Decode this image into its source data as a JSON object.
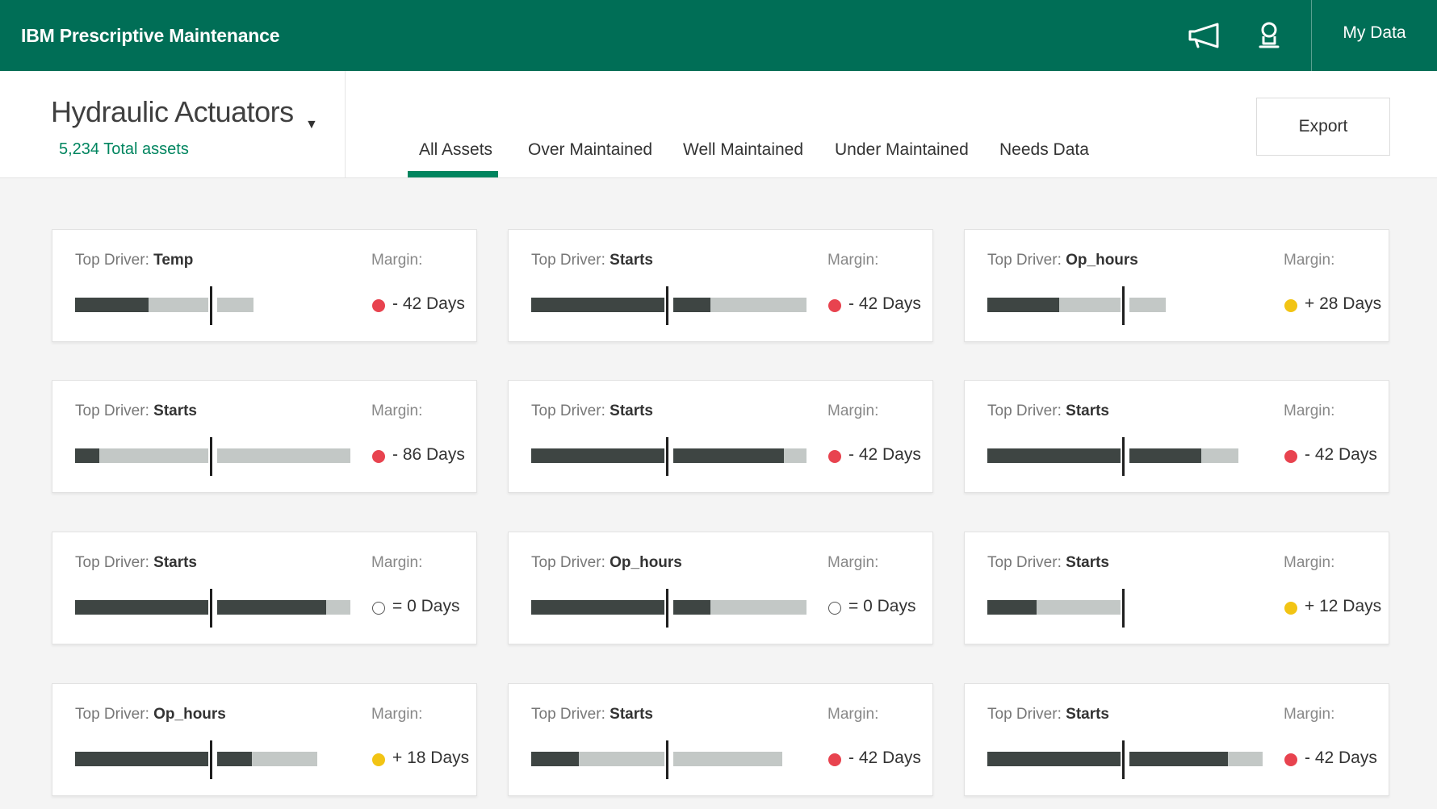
{
  "app": {
    "title": "IBM Prescriptive Maintenance",
    "my_data_label": "My Data",
    "announce_icon": "megaphone-icon",
    "user_icon": "user-icon"
  },
  "selector": {
    "title": "Hydraulic Actuators",
    "total": "5,234 Total assets",
    "caret": "▼"
  },
  "tabs": [
    {
      "label": "All Assets",
      "active": true
    },
    {
      "label": "Over Maintained",
      "active": false
    },
    {
      "label": "Well Maintained",
      "active": false
    },
    {
      "label": "Under Maintained",
      "active": false
    },
    {
      "label": "Needs Data",
      "active": false
    }
  ],
  "export_label": "Export",
  "card_labels": {
    "driver_prefix": "Top Driver: ",
    "margin": "Margin:"
  },
  "status_colors": {
    "red": "#e8434f",
    "yellow": "#f2c414",
    "none": "#ffffff"
  },
  "cards": [
    {
      "driver": "Temp",
      "margin": "- 42 Days",
      "status": "red",
      "bar1": 0.55,
      "bar2": 0.0
    },
    {
      "driver": "Starts",
      "margin": "- 42 Days",
      "status": "red",
      "bar1": 1.0,
      "bar2": 0.28
    },
    {
      "driver": "Op_hours",
      "margin": "+ 28 Days",
      "status": "yellow",
      "bar1": 0.54,
      "bar2": 0.0
    },
    {
      "driver": "Starts",
      "margin": "- 86 Days",
      "status": "red",
      "bar1": 0.18,
      "bar2": 0.0
    },
    {
      "driver": "Starts",
      "margin": "- 42 Days",
      "status": "red",
      "bar1": 1.0,
      "bar2": 0.83
    },
    {
      "driver": "Starts",
      "margin": "- 42 Days",
      "status": "red",
      "bar1": 1.0,
      "bar2": 0.66
    },
    {
      "driver": "Starts",
      "margin": "= 0 Days",
      "status": "none",
      "bar1": 1.0,
      "bar2": 0.82
    },
    {
      "driver": "Op_hours",
      "margin": "= 0 Days",
      "status": "none",
      "bar1": 1.0,
      "bar2": 0.28
    },
    {
      "driver": "Starts",
      "margin": "+ 12 Days",
      "status": "yellow",
      "bar1": 0.37,
      "bar2": null
    },
    {
      "driver": "Op_hours",
      "margin": "+ 18 Days",
      "status": "yellow",
      "bar1": 1.0,
      "bar2": 0.35
    },
    {
      "driver": "Starts",
      "margin": "- 42 Days",
      "status": "red",
      "bar1": 0.36,
      "bar2": 0.0
    },
    {
      "driver": "Starts",
      "margin": "- 42 Days",
      "status": "red",
      "bar1": 1.0,
      "bar2": 0.74
    }
  ]
}
